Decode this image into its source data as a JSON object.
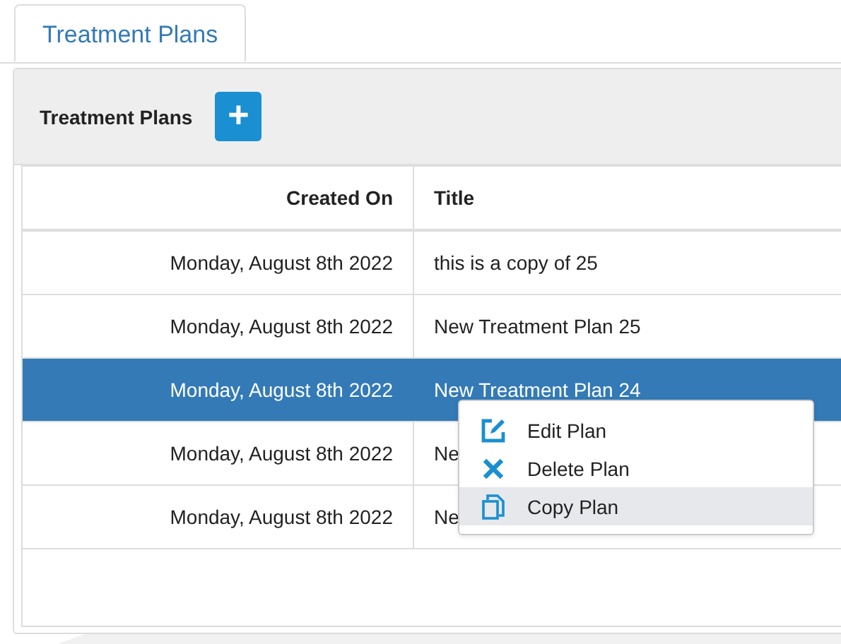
{
  "tabs": [
    {
      "label": "Treatment Plans",
      "selected": true
    }
  ],
  "panel": {
    "title": "Treatment Plans",
    "add_button": "+"
  },
  "table": {
    "columns": [
      "Created On",
      "Title"
    ],
    "rows": [
      {
        "created_on": "Monday, August 8th 2022",
        "title": "this is a copy of 25",
        "selected": false
      },
      {
        "created_on": "Monday, August 8th 2022",
        "title": "New Treatment Plan 25",
        "selected": false
      },
      {
        "created_on": "Monday, August 8th 2022",
        "title": "New Treatment Plan 24",
        "selected": true
      },
      {
        "created_on": "Monday, August 8th 2022",
        "title": "Ne",
        "selected": false
      },
      {
        "created_on": "Monday, August 8th 2022",
        "title": "Ne",
        "selected": false
      }
    ]
  },
  "context_menu": {
    "items": [
      {
        "kind": "edit",
        "label": "Edit Plan",
        "selected": false
      },
      {
        "kind": "delete",
        "label": "Delete Plan",
        "selected": false
      },
      {
        "kind": "copy",
        "label": "Copy Plan",
        "selected": true
      }
    ]
  }
}
